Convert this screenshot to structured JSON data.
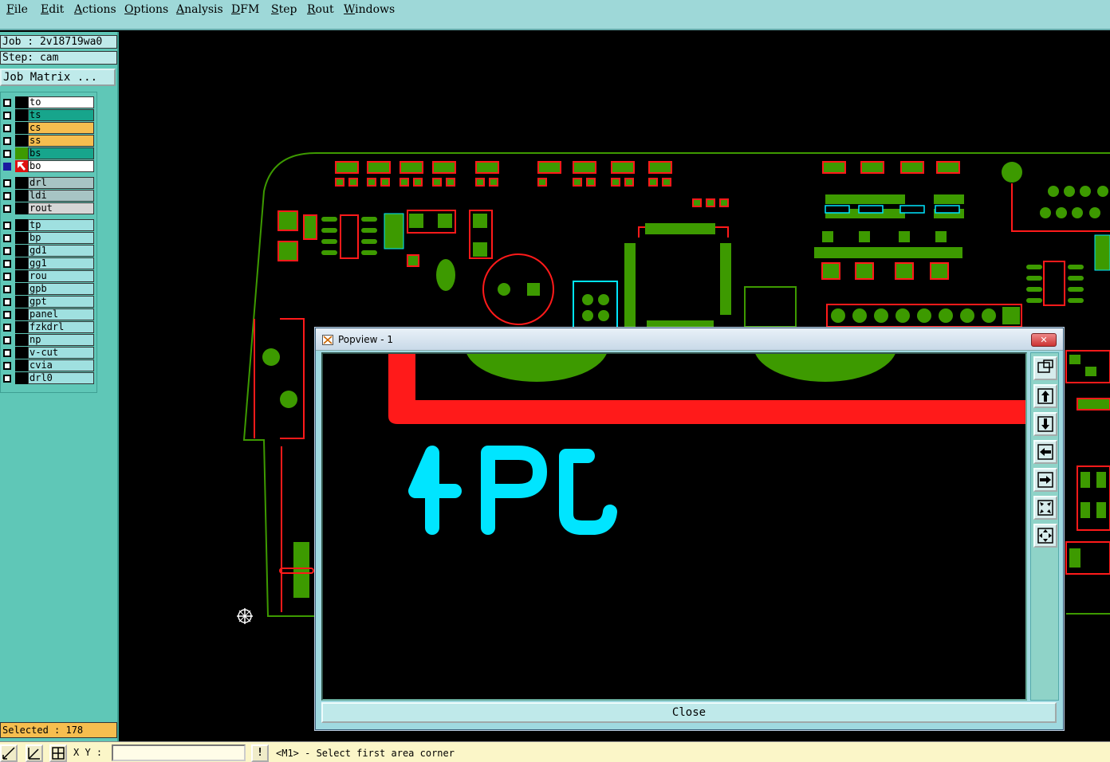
{
  "menu": {
    "items": [
      "File",
      "Edit",
      "Actions",
      "Options",
      "Analysis",
      "DFM",
      "Step",
      "Rout",
      "Windows"
    ]
  },
  "info": {
    "job": "Job : 2v18719wa0",
    "step": "Step: cam",
    "job_matrix_label": "Job Matrix ..."
  },
  "layers": {
    "group1": [
      {
        "name": "to",
        "color": "#ffffff"
      },
      {
        "name": "ts",
        "color": "#17a58c"
      },
      {
        "name": "cs",
        "color": "#f6be4f"
      },
      {
        "name": "ss",
        "color": "#f6be4f"
      },
      {
        "name": "bs",
        "color": "#17a58c"
      },
      {
        "name": "bo",
        "color": "#ffffff"
      }
    ],
    "group2": [
      {
        "name": "drl",
        "color": "#a7c4c4"
      },
      {
        "name": "ldi",
        "color": "#a7c4c4"
      },
      {
        "name": "rout",
        "color": "#d6d6d6"
      }
    ],
    "group3": [
      {
        "name": "tp",
        "color": "#9fe0e0"
      },
      {
        "name": "bp",
        "color": "#9fe0e0"
      },
      {
        "name": "gd1",
        "color": "#9fe0e0"
      },
      {
        "name": "gg1",
        "color": "#9fe0e0"
      },
      {
        "name": "rou",
        "color": "#9fe0e0"
      },
      {
        "name": "gpb",
        "color": "#9fe0e0"
      },
      {
        "name": "gpt",
        "color": "#9fe0e0"
      },
      {
        "name": "panel",
        "color": "#9fe0e0"
      },
      {
        "name": "fzkdrl",
        "color": "#9fe0e0"
      },
      {
        "name": "np",
        "color": "#9fe0e0"
      },
      {
        "name": "v-cut",
        "color": "#9fe0e0"
      },
      {
        "name": "cvia",
        "color": "#9fe0e0"
      },
      {
        "name": "drl0",
        "color": "#9fe0e0"
      }
    ]
  },
  "selected": "Selected : 178",
  "status": {
    "xy_label": "X Y :",
    "xy_value": "",
    "bang": "!",
    "prompt": "<M1> - Select first area corner"
  },
  "popup": {
    "title": "Popview - 1",
    "close_x": "✕",
    "close_label": "Close",
    "jp_text": "JP4"
  },
  "colors": {
    "pcb_red": "#ff1a1a",
    "pcb_green": "#3d9a00",
    "silk_cyan": "#00e5ff",
    "outline_green": "#3d9a00"
  }
}
